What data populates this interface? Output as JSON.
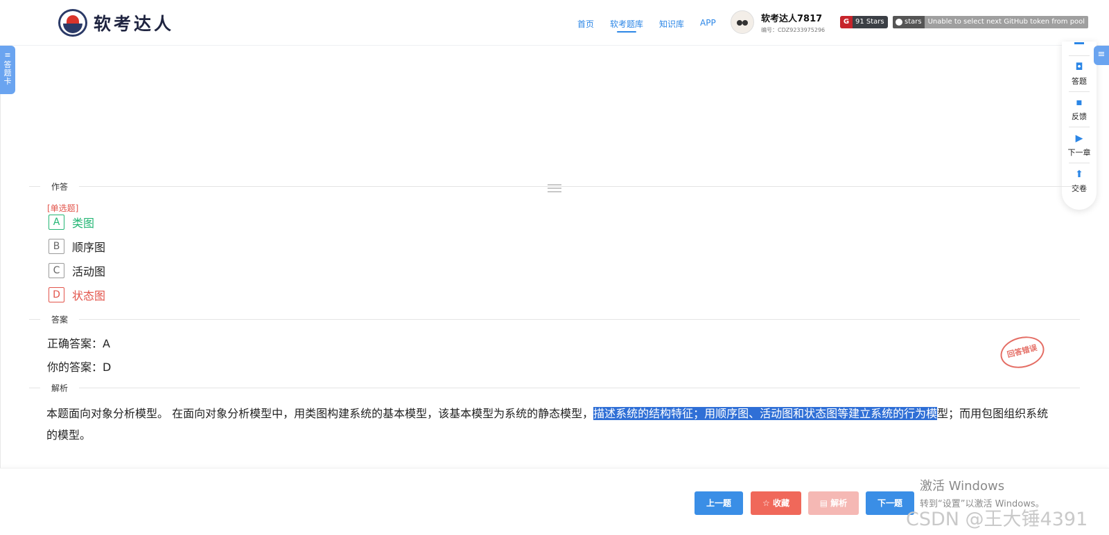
{
  "brand": {
    "name": "软考达人"
  },
  "nav": {
    "items": [
      {
        "label": "首页",
        "active": false
      },
      {
        "label": "软考题库",
        "active": true
      },
      {
        "label": "知识库",
        "active": false
      },
      {
        "label": "APP",
        "active": false
      }
    ]
  },
  "user": {
    "name": "软考达人7817",
    "id": "编号：CDZ9233975296"
  },
  "badges": {
    "stars_icon": "G",
    "stars_text": "91 Stars",
    "github_label": "stars",
    "github_message": "Unable to select next GitHub token from pool"
  },
  "left_tab": {
    "label": "答题卡"
  },
  "right_toolbar": {
    "items": [
      {
        "label": "答题",
        "icon": "answer-icon"
      },
      {
        "label": "反馈",
        "icon": "feedback-icon"
      },
      {
        "label": "下一章",
        "icon": "next-chapter-icon"
      },
      {
        "label": "交卷",
        "icon": "submit-icon"
      }
    ]
  },
  "sections": {
    "answer_area": "作答",
    "answer": "答案",
    "analysis": "解析"
  },
  "question": {
    "type": "[单选题]",
    "options": [
      {
        "letter": "A",
        "text": "类图",
        "state": "correct"
      },
      {
        "letter": "B",
        "text": "顺序图",
        "state": "normal"
      },
      {
        "letter": "C",
        "text": "活动图",
        "state": "normal"
      },
      {
        "letter": "D",
        "text": "状态图",
        "state": "wrong"
      }
    ]
  },
  "answer": {
    "correct": "正确答案：A",
    "yours": "你的答案：D",
    "stamp": "回答错误"
  },
  "analysis": {
    "before": "本题面向对象分析模型。      在面向对象分析模型中，用类图构建系统的基本模型，该基本模型为系统的静态模型，",
    "highlight": "描述系统的结构特征；用顺序图、活动图和状态图等建立系统的行为模",
    "after": "型；而用包图组织系统的模型。"
  },
  "buttons": {
    "prev": "上一题",
    "favorite": "☆ 收藏",
    "analysis": "▤ 解析",
    "next": "下一题"
  },
  "watermarks": {
    "windows_line1": "激活 Windows",
    "windows_line2": "转到“设置”以激活 Windows。",
    "csdn": "CSDN @王大锤4391"
  },
  "colors": {
    "accent": "#2b86e6",
    "correct": "#22b573",
    "wrong": "#e2534a",
    "highlight": "#2f6fd6"
  }
}
